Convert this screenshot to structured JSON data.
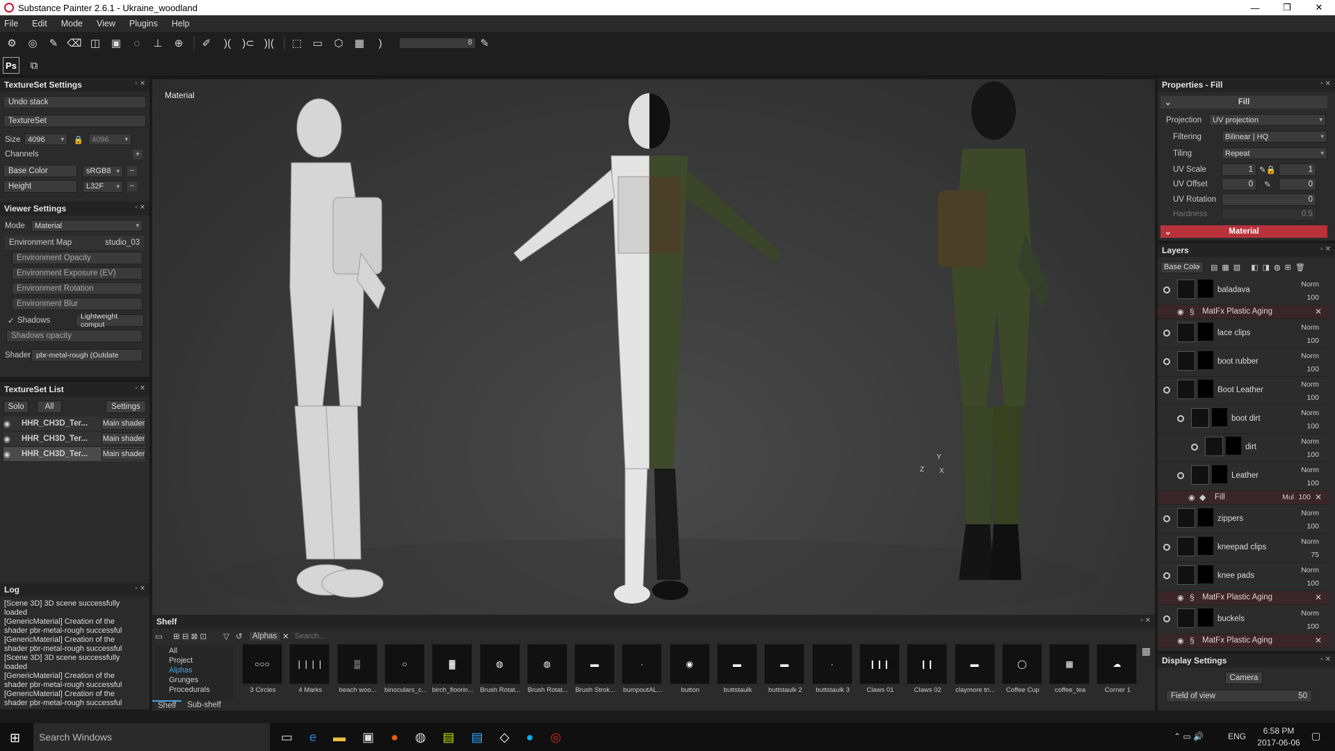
{
  "window": {
    "title": "Substance Painter 2.6.1 - Ukraine_woodland",
    "minimize": "—",
    "maximize": "❐",
    "close": "✕"
  },
  "menu": [
    "File",
    "Edit",
    "Mode",
    "View",
    "Plugins",
    "Help"
  ],
  "toolbar": {
    "slider_value": "8",
    "ps_label": "Ps"
  },
  "textureset_settings": {
    "title": "TextureSet Settings",
    "undo": "Undo stack",
    "textureset": "TextureSet",
    "size_label": "Size",
    "size_value": "4096",
    "size_value2": "4096",
    "channels_label": "Channels",
    "base_color_label": "Base Color",
    "base_color_format": "sRGB8",
    "height_label": "Height",
    "height_format": "L32F"
  },
  "viewer_settings": {
    "title": "Viewer Settings",
    "mode_label": "Mode",
    "mode_value": "Material",
    "env_map_label": "Environment Map",
    "env_map_value": "studio_03",
    "env_opacity": "Environment Opacity",
    "env_exposure": "Environment Exposure (EV)",
    "env_rotation": "Environment Rotation",
    "env_blur": "Environment Blur",
    "shadows_label": "Shadows",
    "shadows_mode": "Lightweight comput",
    "shadows_opacity": "Shadows opacity",
    "shader_label": "Shader",
    "shader_value": "pbr-metal-rough (Outdate"
  },
  "textureset_list": {
    "title": "TextureSet List",
    "solo": "Solo",
    "all": "All",
    "settings": "Settings",
    "items": [
      {
        "name": "HHR_CH3D_Ter...",
        "shader": "Main shader"
      },
      {
        "name": "HHR_CH3D_Ter...",
        "shader": "Main shader"
      },
      {
        "name": "HHR_CH3D_Ter...",
        "shader": "Main shader"
      }
    ]
  },
  "log": {
    "title": "Log",
    "lines": [
      "[Scene 3D] 3D scene successfully loaded",
      "[GenericMaterial] Creation of the shader pbr-metal-rough successful",
      "[GenericMaterial] Creation of the shader pbr-metal-rough successful",
      "[Scene 3D] 3D scene successfully loaded",
      "[GenericMaterial] Creation of the shader pbr-metal-rough successful",
      "[GenericMaterial] Creation of the shader pbr-metal-rough successful"
    ]
  },
  "viewport": {
    "label": "Material",
    "axis_y": "Y",
    "axis_z": "Z",
    "axis_x": "X"
  },
  "shelf": {
    "title": "Shelf",
    "filter_tag": "Alphas",
    "search_placeholder": "Search...",
    "categories": [
      "All",
      "Project",
      "Alphas",
      "Grunges",
      "Procedurals"
    ],
    "tabs": [
      "Shelf",
      "Sub-shelf"
    ],
    "items": [
      "3 Circles",
      "4 Marks",
      "beach woo...",
      "binoculars_c...",
      "birch_floorin...",
      "Brush Rotat...",
      "Brush Rotat...",
      "Brush Strok...",
      "bumpoutAL...",
      "button",
      "buttstaulk",
      "buttstaulk 2",
      "buttstaulk 3",
      "Claws 01",
      "Claws 02",
      "claymore tri...",
      "Coffee Cup",
      "coffee_tea",
      "Corner 1"
    ]
  },
  "properties": {
    "title": "Properties - Fill",
    "fill_label": "Fill",
    "projection_label": "Projection",
    "projection_value": "UV projection",
    "filtering_label": "Filtering",
    "filtering_value": "Bilinear | HQ",
    "tiling_label": "Tiling",
    "tiling_value": "Repeat",
    "uvscale_label": "UV Scale",
    "uvscale_a": "1",
    "uvscale_b": "1",
    "uvoffset_label": "UV Offset",
    "uvoffset_a": "0",
    "uvoffset_b": "0",
    "uvrotation_label": "UV Rotation",
    "uvrotation_value": "0",
    "hardness_label": "Hardness",
    "hardness_value": "0.5",
    "material_label": "Material"
  },
  "layers": {
    "title": "Layers",
    "channel": "Base Colc",
    "rows": [
      {
        "name": "baladava",
        "blend": "Norm",
        "opacity": "100"
      },
      {
        "fx": "MatFx Plastic Aging"
      },
      {
        "name": "lace clips",
        "blend": "Norm",
        "opacity": "100"
      },
      {
        "name": "boot rubber",
        "blend": "Norm",
        "opacity": "100"
      },
      {
        "name": "Boot Leather",
        "blend": "Norm",
        "opacity": "100"
      },
      {
        "name": "boot dirt",
        "blend": "Norm",
        "opacity": "100"
      },
      {
        "name": "dirt",
        "blend": "Norm",
        "opacity": "100"
      },
      {
        "name": "Leather",
        "blend": "Norm",
        "opacity": "100"
      },
      {
        "fill": "Fill",
        "blend": "Mul",
        "opacity": "100"
      },
      {
        "name": "zippers",
        "blend": "Norm",
        "opacity": "100"
      },
      {
        "name": "kneepad clips",
        "blend": "Norm",
        "opacity": "75"
      },
      {
        "name": "knee pads",
        "blend": "Norm",
        "opacity": "100"
      },
      {
        "fx": "MatFx Plastic Aging"
      },
      {
        "name": "buckels",
        "blend": "Norm",
        "opacity": "100"
      },
      {
        "fx": "MatFx Plastic Aging"
      }
    ]
  },
  "display_settings": {
    "title": "Display Settings",
    "camera": "Camera",
    "fov_label": "Field of view",
    "fov_value": "50"
  },
  "taskbar": {
    "search": "Search Windows",
    "lang": "ENG",
    "time": "6:58 PM",
    "date": "2017-06-06"
  },
  "colors": {
    "accent_red": "#b8323a",
    "selected_blue": "#4aa3e0"
  }
}
